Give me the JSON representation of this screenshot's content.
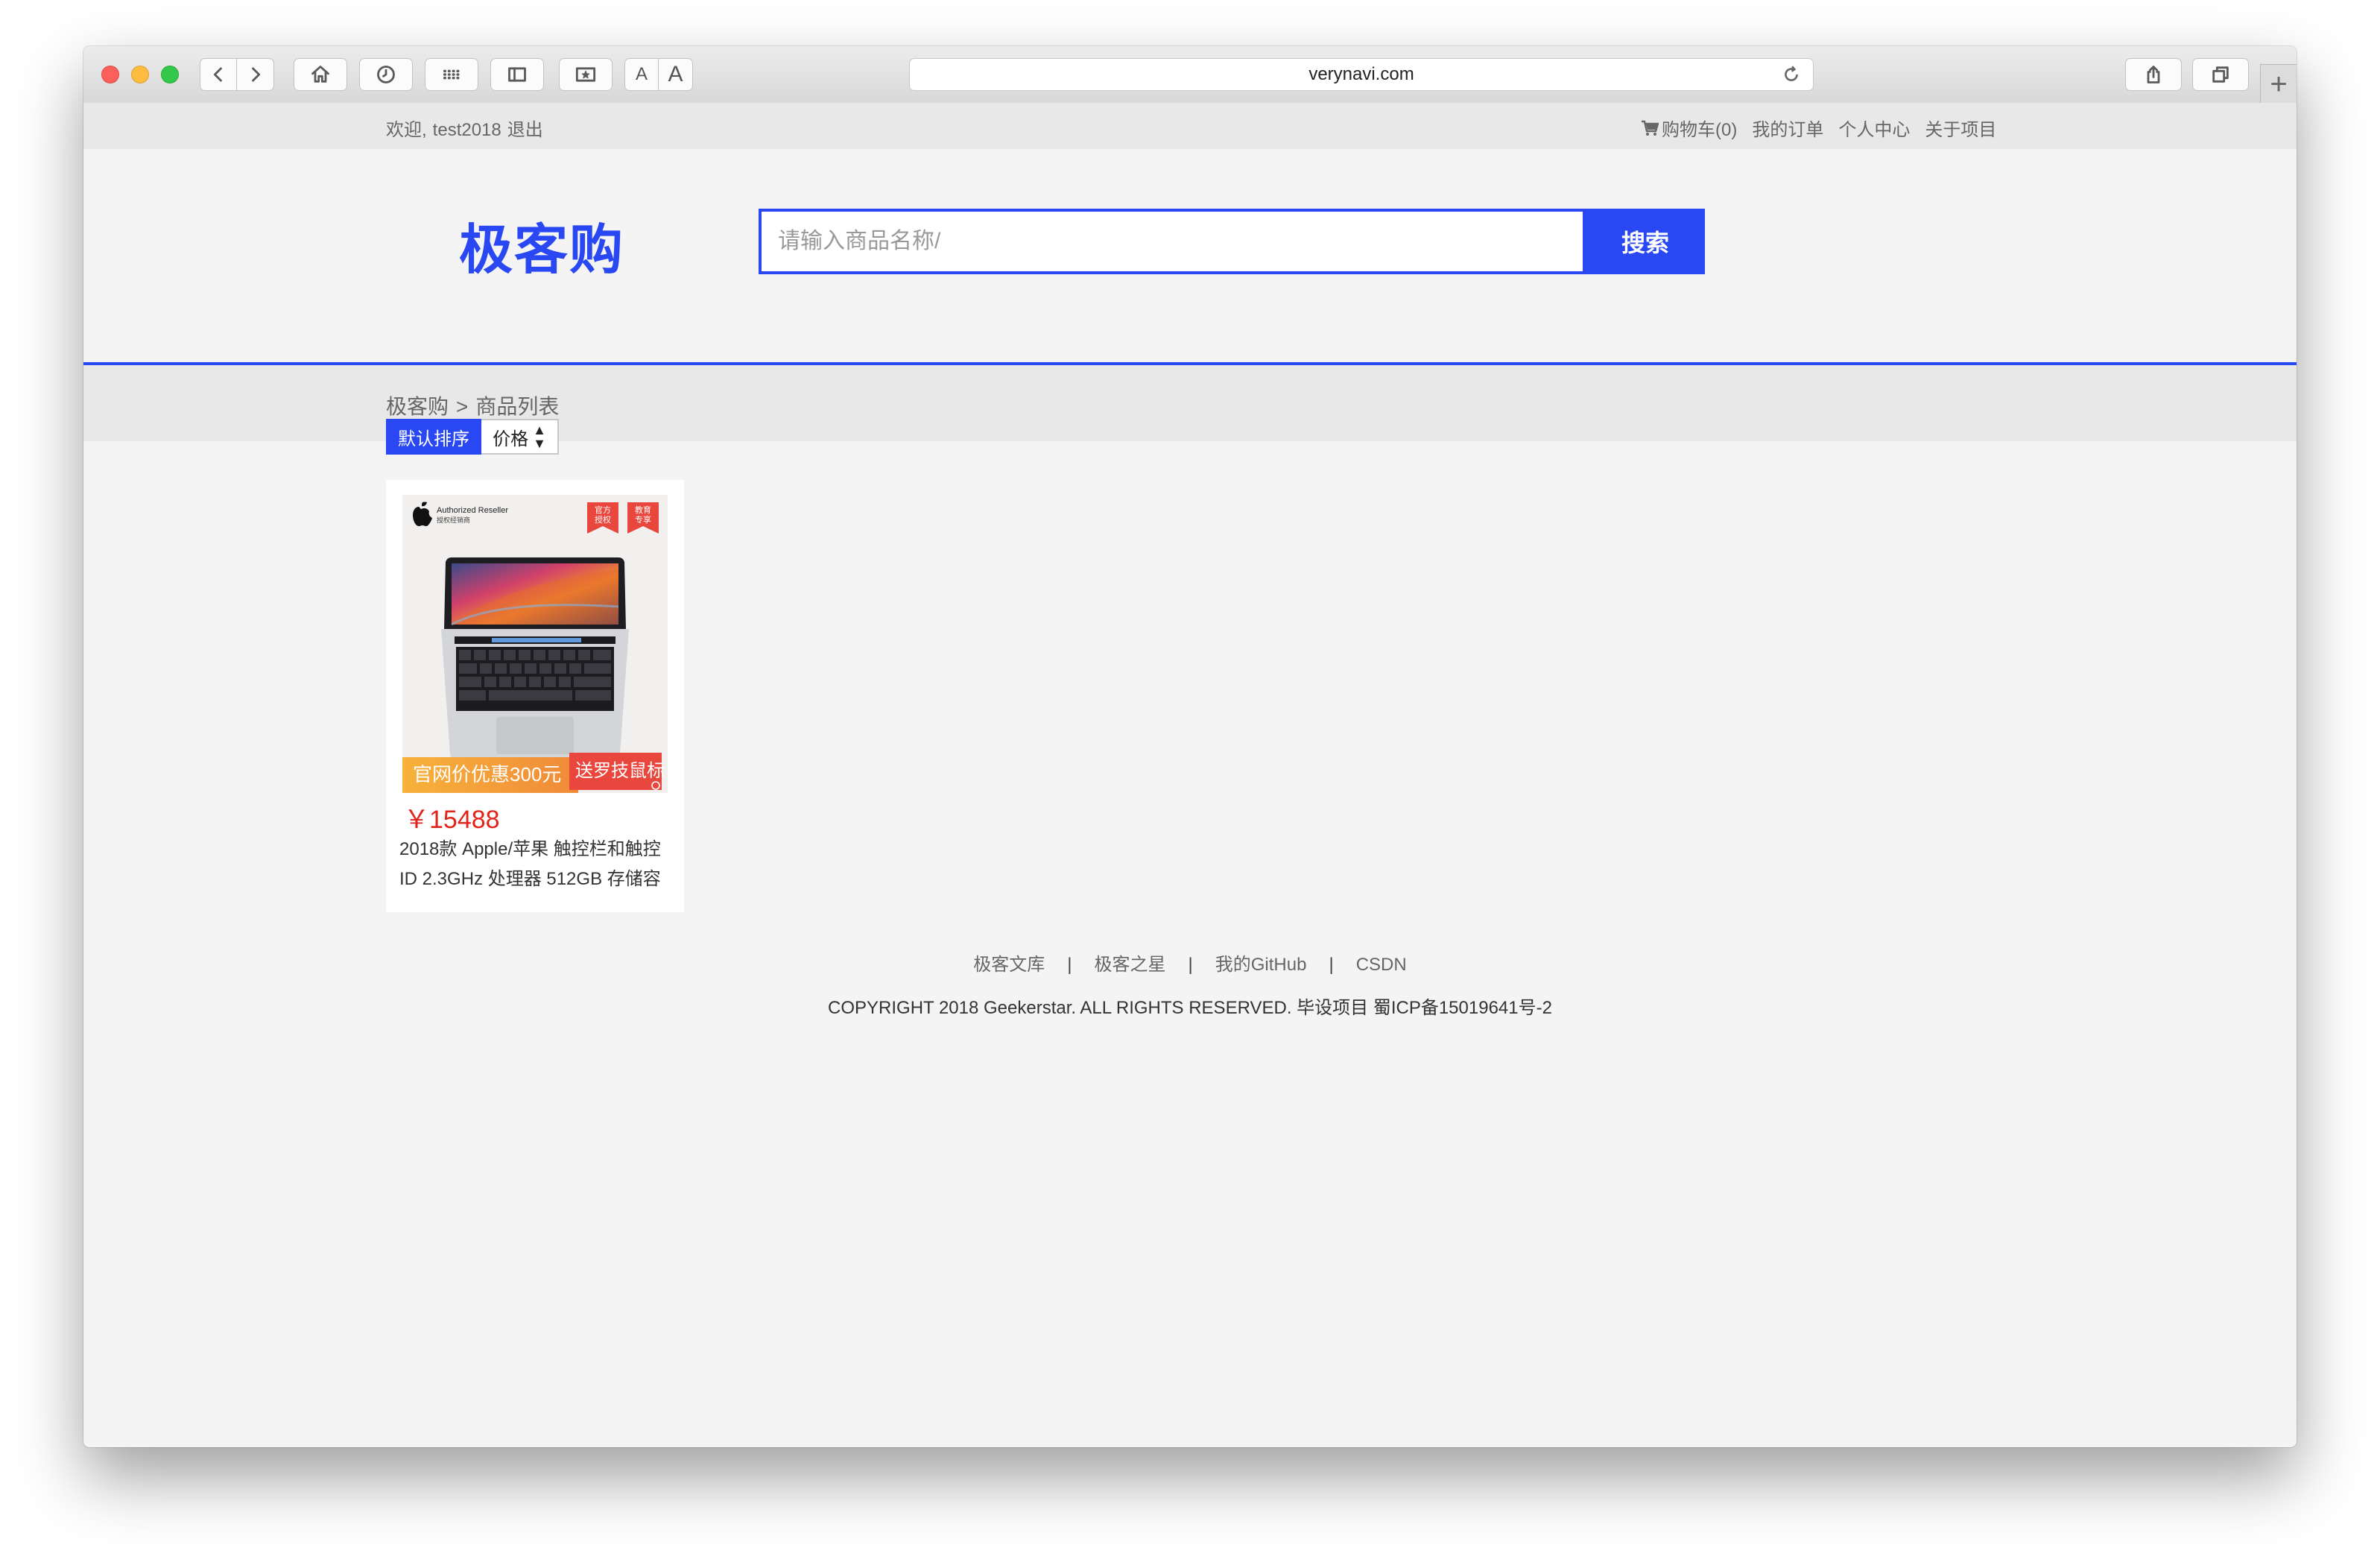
{
  "browser": {
    "url": "verynavi.com",
    "text_size_small": "A",
    "text_size_large": "A",
    "new_tab": "+"
  },
  "topbar": {
    "welcome_prefix": "欢迎,",
    "username": "test2018",
    "logout": "退出",
    "cart": "购物车(0)",
    "orders": "我的订单",
    "profile": "个人中心",
    "about": "关于项目"
  },
  "header": {
    "logo": "极客购",
    "search_placeholder": "请输入商品名称/",
    "search_button": "搜索"
  },
  "breadcrumb": {
    "home": "极客购",
    "separator": ">",
    "current": "商品列表"
  },
  "sort": {
    "default": "默认排序",
    "price": "价格"
  },
  "product": {
    "image_reseller_line1": "Authorized Reseller",
    "image_reseller_line2": "授权经销商",
    "image_tag1_line1": "官方",
    "image_tag1_line2": "授权",
    "image_tag2_line1": "教育",
    "image_tag2_line2": "专享",
    "image_promo": "官网价优惠300元",
    "image_gift": "送罗技鼠标",
    "price": "￥15488",
    "title": "2018款 Apple/苹果 触控栏和触控ID 2.3GHz 处理器 512GB 存储容"
  },
  "footer": {
    "links": [
      "极客文库",
      "极客之星",
      "我的GitHub",
      "CSDN"
    ],
    "separator": "|",
    "copyright": "COPYRIGHT 2018 Geekerstar. ALL RIGHTS RESERVED. 毕设项目 蜀ICP备15019641号-2"
  },
  "colors": {
    "accent": "#2947f2",
    "price": "#e2231a",
    "close": "#fc605c",
    "minimize": "#fdbc40",
    "zoom": "#34c84a"
  }
}
